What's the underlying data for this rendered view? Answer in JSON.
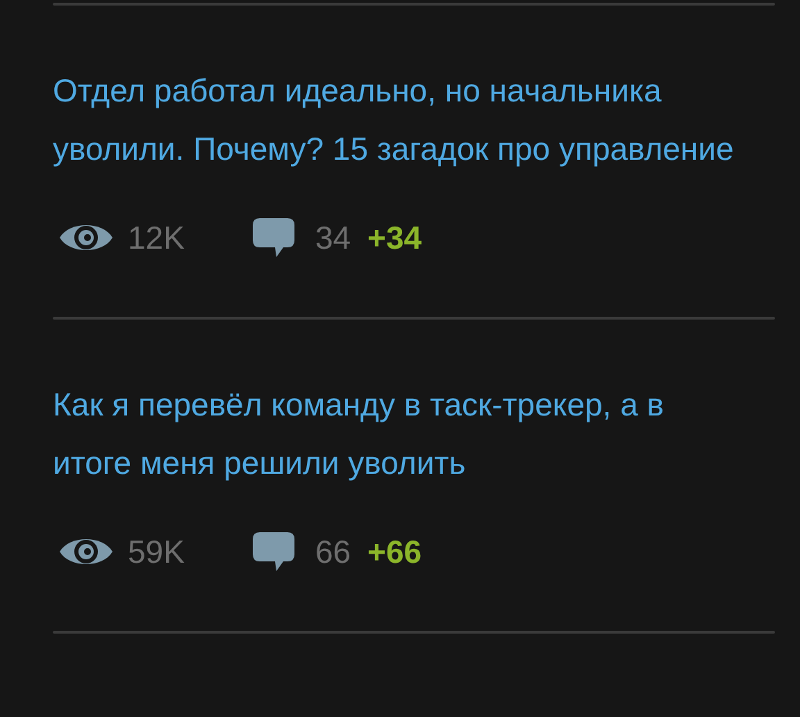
{
  "articles": [
    {
      "title": "Отдел работал идеально, но начальника уволили. Почему? 15 загадок про управление",
      "views": "12K",
      "comments": "34",
      "new_comments": "+34"
    },
    {
      "title": "Как я перевёл команду в таск-трекер, а в итоге меня решили уволить",
      "views": "59K",
      "comments": "66",
      "new_comments": "+66"
    }
  ]
}
